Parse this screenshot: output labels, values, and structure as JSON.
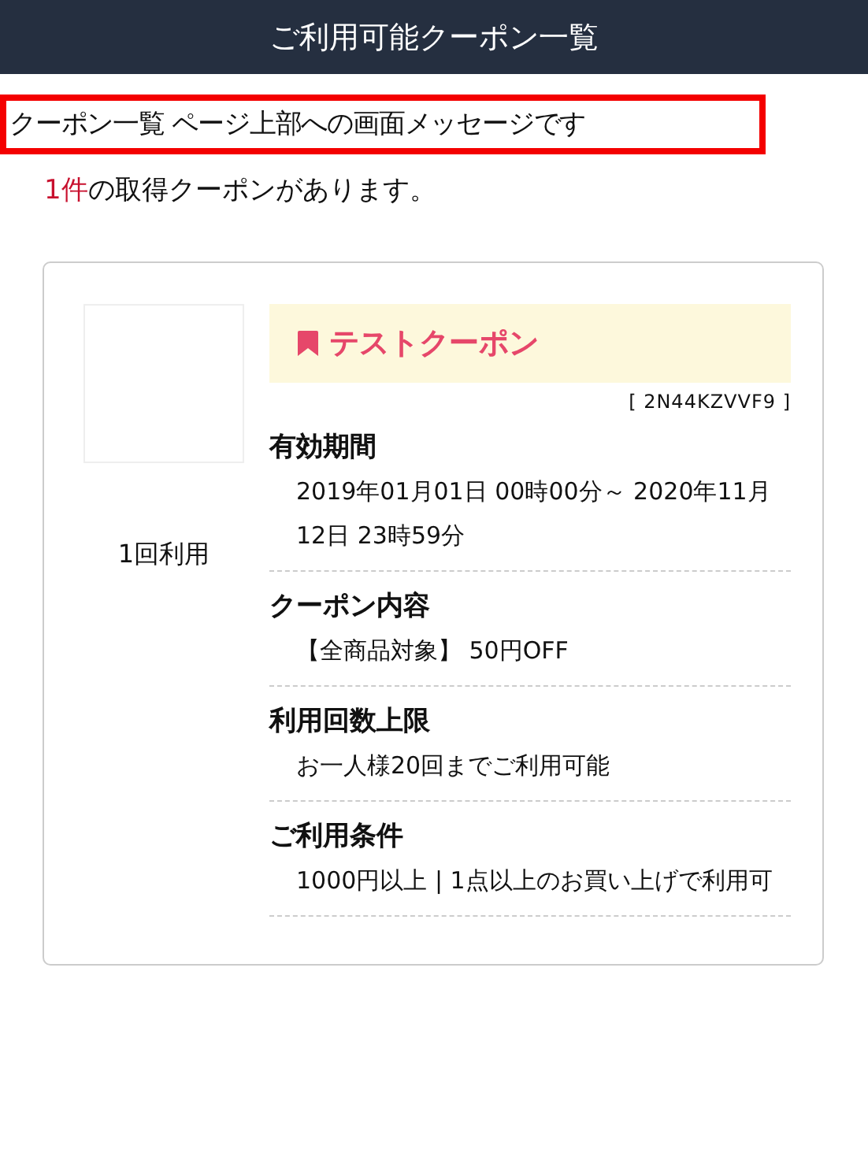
{
  "header": {
    "title": "ご利用可能クーポン一覧"
  },
  "message": "クーポン一覧 ページ上部への画面メッセージです",
  "summary": {
    "count": "1件",
    "text": "の取得クーポンがあります。"
  },
  "coupons": [
    {
      "usage": "1回利用",
      "title": "テストクーポン",
      "code": "[ 2N44KZVVF9 ]",
      "sections": [
        {
          "heading": "有効期間",
          "body": "2019年01月01日 00時00分～ 2020年11月12日 23時59分"
        },
        {
          "heading": "クーポン内容",
          "body": "【全商品対象】 50円OFF"
        },
        {
          "heading": "利用回数上限",
          "body": "お一人様20回までご利用可能"
        },
        {
          "heading": "ご利用条件",
          "body": "1000円以上 | 1点以上のお買い上げで利用可"
        }
      ]
    }
  ]
}
